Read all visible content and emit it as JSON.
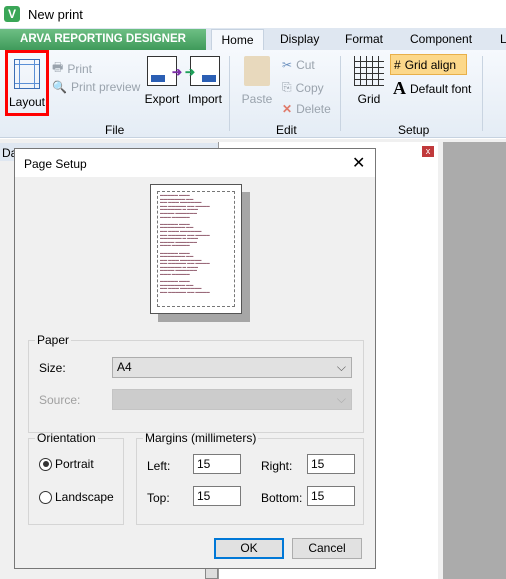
{
  "window": {
    "title": "New print",
    "logo": "V"
  },
  "ribbon": {
    "brand": "ARVA REPORTING DESIGNER",
    "tabs": [
      "Home",
      "Display",
      "Format",
      "Component",
      "L"
    ],
    "file": {
      "layout": "Layout",
      "print": "Print",
      "print_preview": "Print preview",
      "export": "Export",
      "import": "Import",
      "group": "File"
    },
    "edit": {
      "paste": "Paste",
      "cut": "Cut",
      "copy": "Copy",
      "delete": "Delete",
      "group": "Edit"
    },
    "setup": {
      "grid": "Grid",
      "grid_align": "Grid align",
      "default_font": "Default font",
      "group": "Setup"
    },
    "highlight_color": "#ff0000"
  },
  "panel": {
    "title": "Da",
    "close": "x"
  },
  "dialog": {
    "title": "Page Setup",
    "close": "✕",
    "paper": {
      "legend": "Paper",
      "size_label": "Size:",
      "size_value": "A4",
      "source_label": "Source:",
      "source_value": ""
    },
    "orientation": {
      "legend": "Orientation",
      "portrait": "Portrait",
      "landscape": "Landscape",
      "selected": "Portrait"
    },
    "margins": {
      "legend": "Margins (millimeters)",
      "left_label": "Left:",
      "left": "15",
      "right_label": "Right:",
      "right": "15",
      "top_label": "Top:",
      "top": "15",
      "bottom_label": "Bottom:",
      "bottom": "15"
    },
    "ok": "OK",
    "cancel": "Cancel"
  }
}
